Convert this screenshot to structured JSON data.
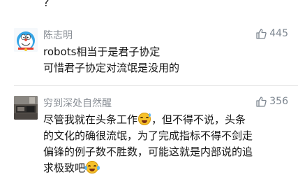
{
  "top": {
    "mark": "?"
  },
  "comments": [
    {
      "username": "陈志明",
      "likes": "445",
      "lines": [
        "robots相当于是君子协定",
        "可惜君子协定对流氓是没用的"
      ],
      "avatar_icon": "doraemon-avatar"
    },
    {
      "username": "穷到深处自然醒",
      "likes": "356",
      "lines_parts": [
        [
          "尽管我就在头条工作",
          "，但不得不说，头条"
        ],
        [
          "的文化的确很流氓，为了完成指标不得不剑走"
        ],
        [
          "偏锋的例子数不胜数，可能这就是内部说的追"
        ],
        [
          "求极致吧"
        ]
      ],
      "avatar_icon": "room-photo-avatar"
    }
  ],
  "colors": {
    "username": "#8a8f96",
    "likes": "#7d8690",
    "text": "#161616",
    "divider": "#e6e6e6"
  }
}
